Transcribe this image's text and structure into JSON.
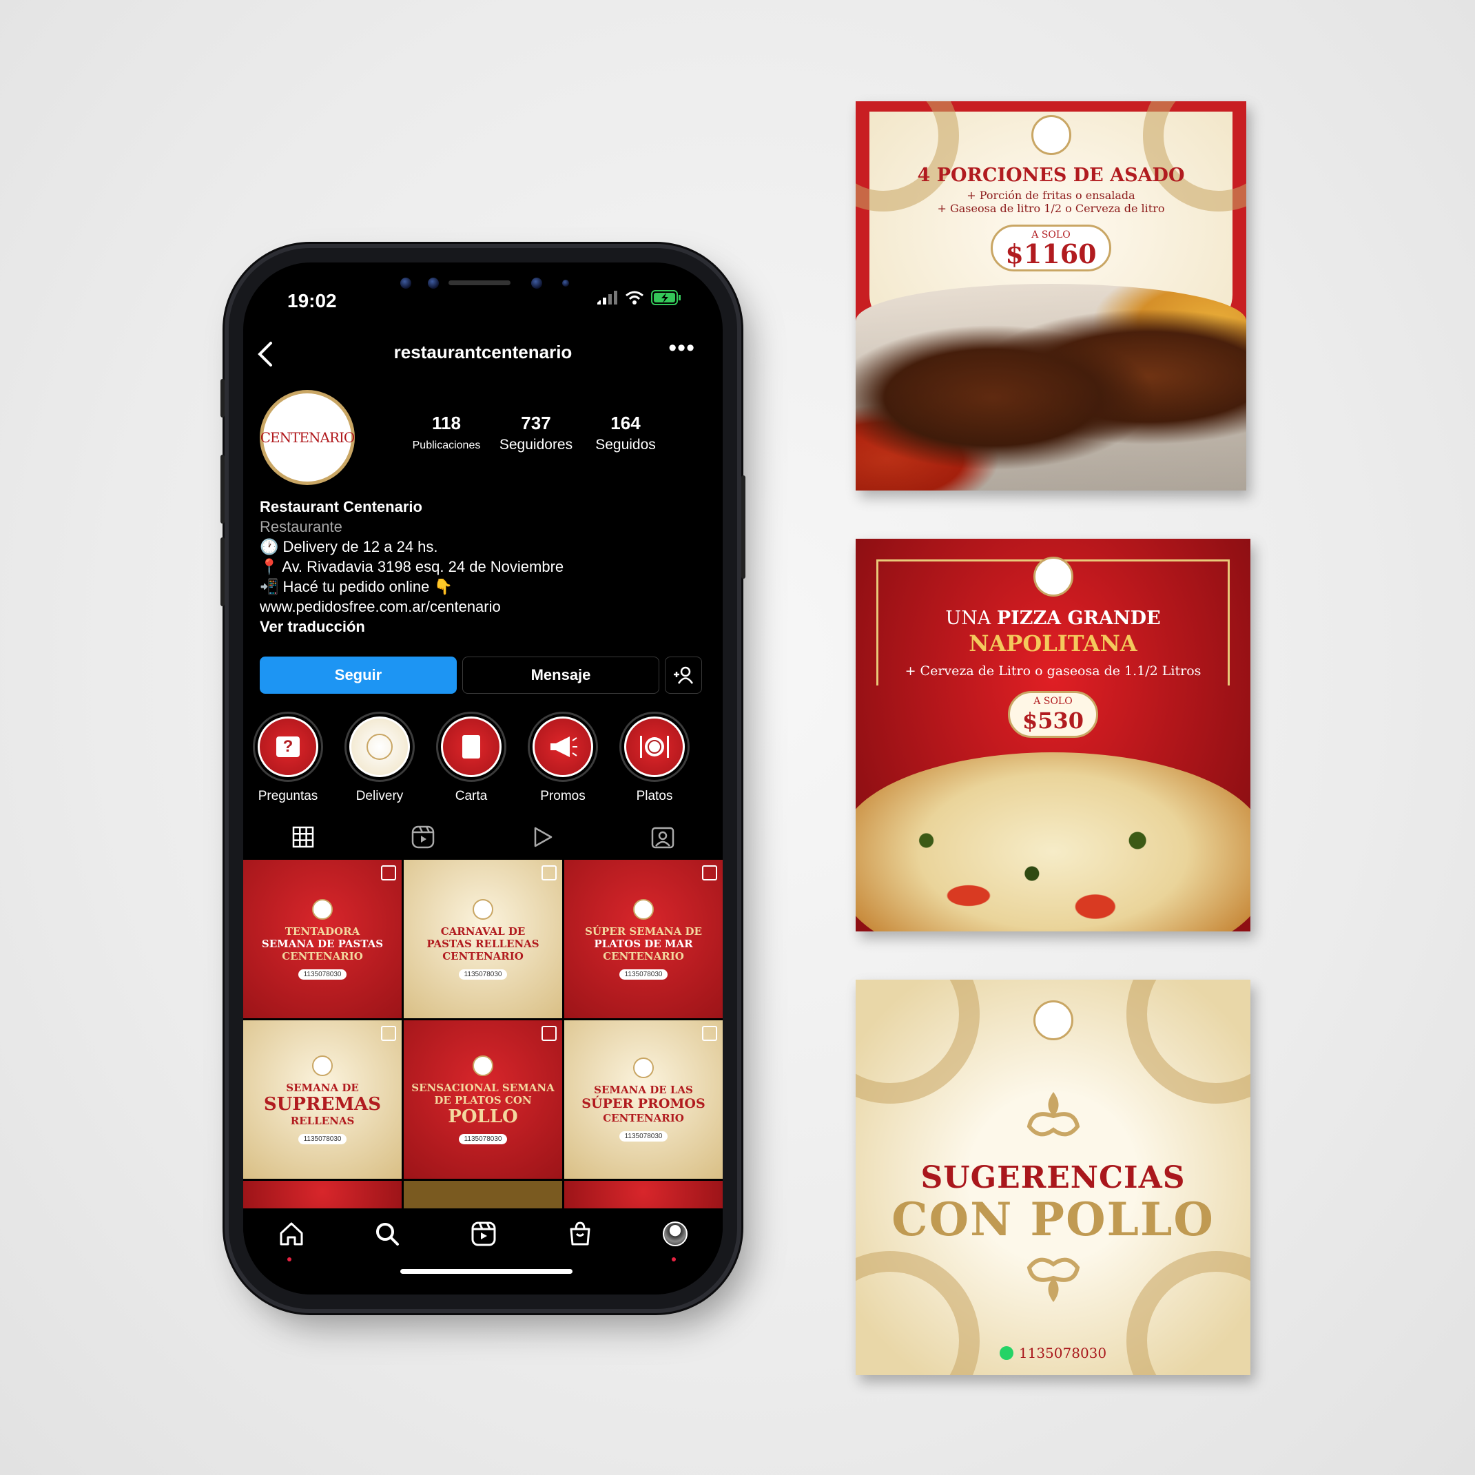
{
  "colors": {
    "accent": "#1d95f3",
    "brand_red": "#b11b1f",
    "brand_gold": "#c9a664"
  },
  "status": {
    "time": "19:02"
  },
  "profile": {
    "username": "restaurantcentenario",
    "avatar_text": "CENTENARIO",
    "stats": [
      {
        "value": "118",
        "label": "Publicaciones"
      },
      {
        "value": "737",
        "label": "Seguidores"
      },
      {
        "value": "164",
        "label": "Seguidos"
      }
    ],
    "name": "Restaurant Centenario",
    "category": "Restaurante",
    "bio": [
      "🕐 Delivery de 12 a 24 hs.",
      "📍 Av. Rivadavia 3198 esq. 24 de Noviembre",
      "📲 Hacé tu pedido online 👇",
      "www.pedidosfree.com.ar/centenario"
    ],
    "translate": "Ver traducción",
    "buttons": {
      "follow": "Seguir",
      "message": "Mensaje"
    }
  },
  "highlights": [
    {
      "label": "Preguntas",
      "icon": "question-icon"
    },
    {
      "label": "Delivery",
      "icon": "delivery-icon"
    },
    {
      "label": "Carta",
      "icon": "menu-book-icon"
    },
    {
      "label": "Promos",
      "icon": "megaphone-icon"
    },
    {
      "label": "Platos",
      "icon": "plate-icon"
    }
  ],
  "posts": [
    {
      "lines": [
        "TENTADORA",
        "SEMANA DE PASTAS",
        "CENTENARIO"
      ],
      "phone": "1135078030"
    },
    {
      "lines": [
        "CARNAVAL DE",
        "PASTAS RELLENAS",
        "CENTENARIO"
      ],
      "phone": "1135078030"
    },
    {
      "lines": [
        "SÚPER SEMANA DE",
        "PLATOS DE MAR",
        "CENTENARIO"
      ],
      "phone": "1135078030"
    },
    {
      "lines": [
        "SEMANA DE",
        "SUPREMAS",
        "RELLENAS"
      ],
      "phone": "1135078030"
    },
    {
      "lines": [
        "SENSACIONAL SEMANA",
        "DE PLATOS CON",
        "POLLO"
      ],
      "phone": "1135078030"
    },
    {
      "lines": [
        "SEMANA DE LAS",
        "SÚPER PROMOS",
        "CENTENARIO"
      ],
      "phone": "1135078030"
    }
  ],
  "cards": {
    "asado": {
      "title": "4 PORCIONES DE ASADO",
      "line1": "+ Porción de fritas o ensalada",
      "line2": "+ Gaseosa de litro 1/2 o Cerveza de litro",
      "pre": "A SOLO",
      "price": "$1160"
    },
    "pizza": {
      "pre_title": "UNA",
      "title_bold": "PIZZA GRANDE",
      "subtitle": "NAPOLITANA",
      "line1": "+ Cerveza de Litro o gaseosa de 1.1/2 Litros",
      "pre": "A SOLO",
      "price": "$530"
    },
    "pollo": {
      "title1": "SUGERENCIAS",
      "title2": "CON POLLO",
      "phone": "1135078030"
    }
  }
}
